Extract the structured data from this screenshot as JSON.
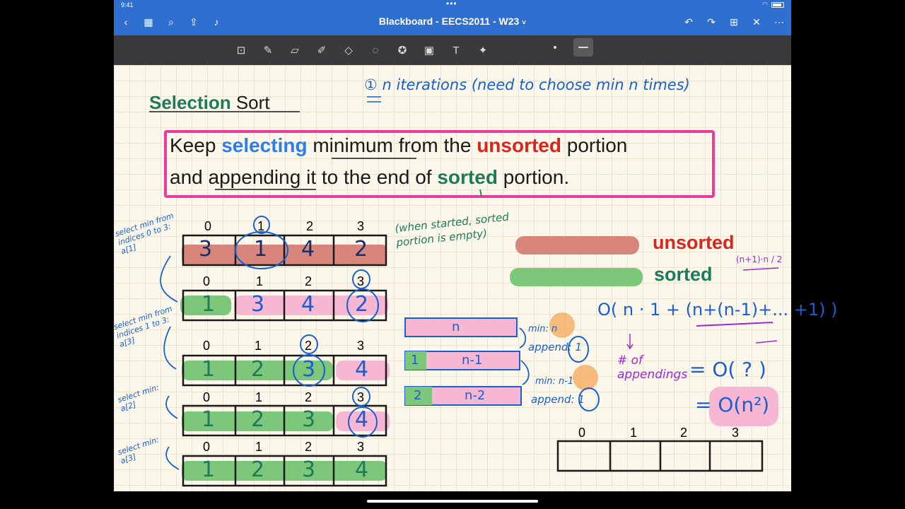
{
  "status": {
    "time": "9:41"
  },
  "app": {
    "title": "Blackboard - EECS2011 - W23",
    "title_chevron": "˅"
  },
  "toolbar": {
    "tools": [
      "lasso-image-icon",
      "pen-icon",
      "eraser-icon",
      "highlighter-icon",
      "shapes-icon",
      "lasso-icon",
      "sticker-icon",
      "image-icon",
      "textbox-icon",
      "laser-pointer-icon"
    ]
  },
  "note": {
    "heading": {
      "bold": "Selection",
      "rest": "Sort"
    },
    "box": {
      "line1": [
        "Keep",
        "selecting",
        "minimum",
        "from the",
        "unsorted",
        "portion"
      ],
      "line2": [
        "and",
        "appending",
        "it to the end of",
        "sorted",
        "portion."
      ]
    },
    "top_annotation": "① n iterations (need to choose min n times)",
    "started_note": "(when started, sorted portion is empty)",
    "legend": {
      "unsorted": "unsorted",
      "sorted": "sorted"
    },
    "indices": [
      "0",
      "1",
      "2",
      "3"
    ],
    "rows": [
      {
        "label": "select min from indices 0 to 3: a[1]",
        "cells": [
          "3",
          "1",
          "4",
          "2"
        ]
      },
      {
        "label": "select min from indices 1 to 3: a[3]",
        "cells": [
          "1",
          "3",
          "4",
          "2"
        ]
      },
      {
        "label": "select min: a[2]",
        "cells": [
          "1",
          "2",
          "3",
          "4"
        ]
      },
      {
        "label": "select min: a[3]",
        "cells": [
          "1",
          "2",
          "3",
          "4"
        ]
      },
      {
        "label": "",
        "cells": [
          "1",
          "2",
          "3",
          "4"
        ]
      }
    ],
    "bars": [
      {
        "left": "",
        "mid": "n"
      },
      {
        "left": "1",
        "mid": "n-1"
      },
      {
        "left": "2",
        "mid": "n-2"
      }
    ],
    "bar_notes": {
      "n1": "min: n",
      "a1": "append: 1",
      "n2": "min: n-1",
      "a2": "append: 1"
    },
    "complexity": {
      "expr": "O( n · 1 + (n+(n-1)+... +1) )",
      "frac": "(n+1)·n / 2",
      "appendings": "# of appendings",
      "eq1": "= O( ? )",
      "eq2": "= O(n²)"
    }
  },
  "colors": {
    "blue_ui": "#2f6fd0",
    "toolbar": "#3a3a3c",
    "paper": "#fbf7ea",
    "pink": "#ee3a9a",
    "red_text": "#d8261c",
    "green_text": "#1f7a5a",
    "ink_blue": "#1a5fd1",
    "unsorted_fill": "#d8857c",
    "sorted_fill": "#7cc77a",
    "pink_fill": "#f7b6d2",
    "purple": "#9b2bd6",
    "orange": "#f5a855"
  }
}
